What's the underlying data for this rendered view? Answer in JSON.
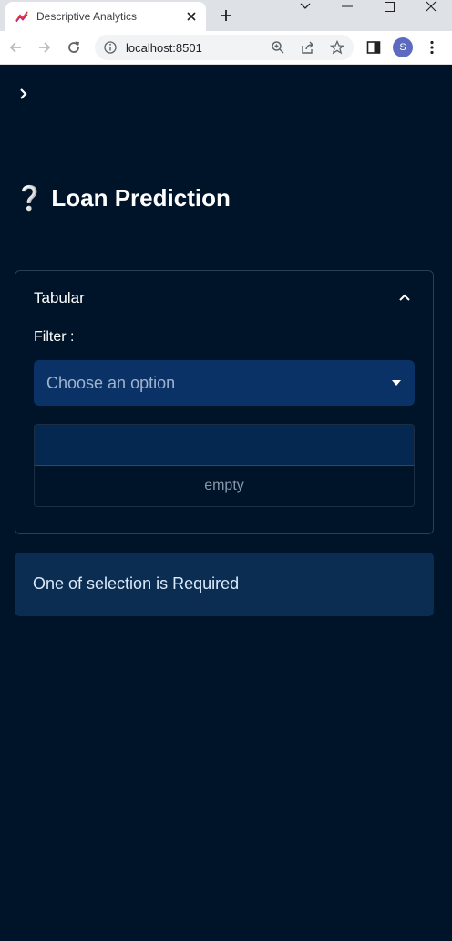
{
  "browser": {
    "tab_title": "Descriptive Analytics",
    "url": "localhost:8501",
    "profile_initial": "S"
  },
  "app": {
    "title": "Loan Prediction",
    "title_icon": "❔",
    "expander": {
      "label": "Tabular",
      "expanded": true,
      "filter_label": "Filter :",
      "select_placeholder": "Choose an option",
      "table_empty_text": "empty"
    },
    "alert_message": "One of selection is Required"
  },
  "colors": {
    "background": "#001429",
    "select_bg": "#0a3266",
    "alert_bg": "#0c2d52",
    "text": "#ffffff"
  }
}
